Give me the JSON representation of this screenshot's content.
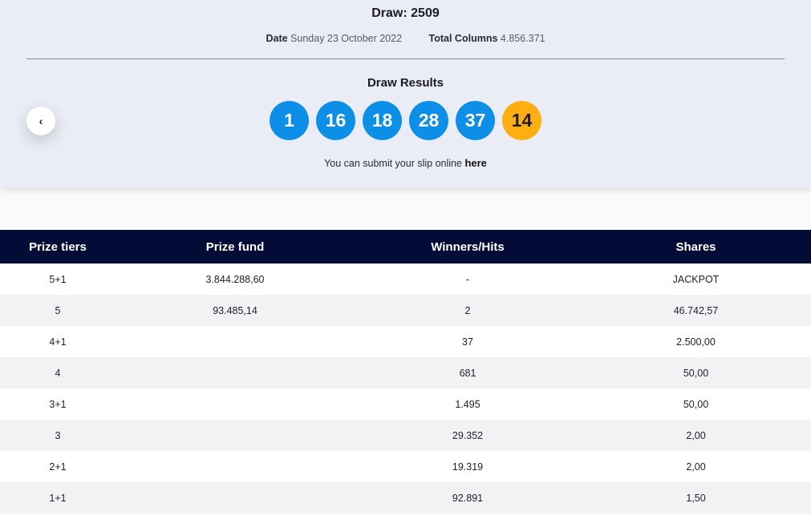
{
  "header": {
    "draw_label": "Draw:",
    "draw_number": "2509",
    "date_label": "Date",
    "date_value": "Sunday 23 October 2022",
    "columns_label": "Total Columns",
    "columns_value": "4.856.371"
  },
  "results": {
    "title": "Draw Results",
    "numbers": [
      "1",
      "16",
      "18",
      "28",
      "37"
    ],
    "bonus": "14",
    "submit_text": "You can submit your slip online",
    "submit_link": "here"
  },
  "nav": {
    "back_icon": "chevron-left-icon",
    "back_glyph": "‹"
  },
  "colors": {
    "ball": "#0d8fe8",
    "bonus_ball": "#ffae12",
    "table_header": "#030c37"
  },
  "table": {
    "columns": [
      "Prize tiers",
      "Prize fund",
      "Winners/Hits",
      "Shares"
    ],
    "rows": [
      [
        "5+1",
        "3.844.288,60",
        "-",
        "JACKPOT"
      ],
      [
        "5",
        "93.485,14",
        "2",
        "46.742,57"
      ],
      [
        "4+1",
        "",
        "37",
        "2.500,00"
      ],
      [
        "4",
        "",
        "681",
        "50,00"
      ],
      [
        "3+1",
        "",
        "1.495",
        "50,00"
      ],
      [
        "3",
        "",
        "29.352",
        "2,00"
      ],
      [
        "2+1",
        "",
        "19.319",
        "2,00"
      ],
      [
        "1+1",
        "",
        "92.891",
        "1,50"
      ]
    ]
  }
}
